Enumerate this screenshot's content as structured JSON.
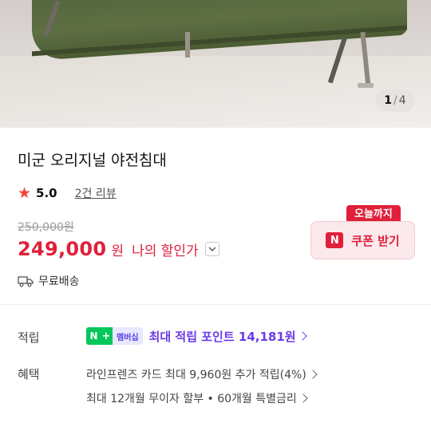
{
  "image": {
    "counter_current": "1",
    "counter_separator": "/",
    "counter_total": "4"
  },
  "product": {
    "title": "미군 오리지널 야전침대",
    "rating": "5.0",
    "review_link": "2건 리뷰",
    "original_price": "250,000원",
    "price": "249,000",
    "currency": "원",
    "my_discount_label": "나의 할인가",
    "shipping": "무료배송"
  },
  "coupon": {
    "tag": "오늘까지",
    "badge": "N",
    "label": "쿠폰 받기"
  },
  "points": {
    "row_label": "적립",
    "badge_n": "N",
    "badge_plus": "+",
    "badge_member": "멤버십",
    "text": "최대 적립 포인트 14,181원"
  },
  "benefits": {
    "row_label": "혜택",
    "items": [
      "라인프렌즈 카드 최대 9,960원 추가 적립(4%)",
      "최대 12개월 무이자 할부 • 60개월 특별금리"
    ]
  },
  "colors": {
    "accent_red": "#e0203a",
    "naver_green": "#03c75a",
    "points_purple": "#6a3be6"
  },
  "icons": [
    "star-icon",
    "chevron-down-icon",
    "truck-icon",
    "chevron-right-icon"
  ]
}
